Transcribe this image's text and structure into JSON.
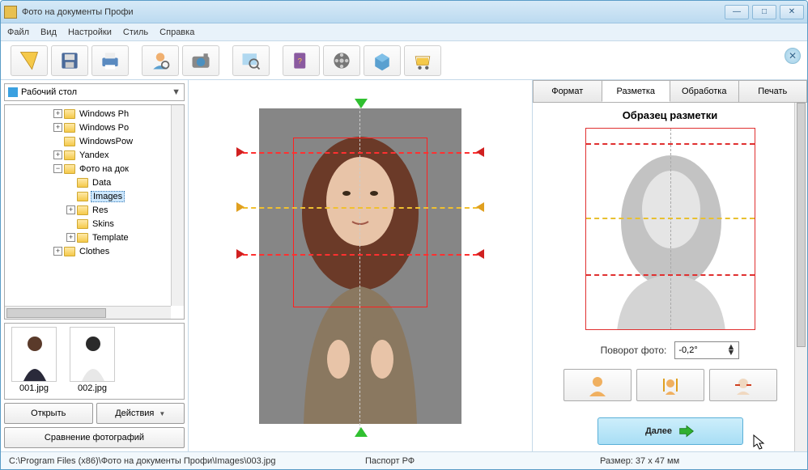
{
  "title": "Фото на документы Профи",
  "menu": {
    "file": "Файл",
    "view": "Вид",
    "settings": "Настройки",
    "style": "Стиль",
    "help": "Справка"
  },
  "folderSelect": "Рабочий стол",
  "tree": {
    "items": [
      {
        "indent": 60,
        "exp": "+",
        "label": "Windows Ph"
      },
      {
        "indent": 60,
        "exp": "+",
        "label": "Windows Po"
      },
      {
        "indent": 60,
        "exp": "",
        "label": "WindowsPow"
      },
      {
        "indent": 60,
        "exp": "+",
        "label": "Yandex"
      },
      {
        "indent": 60,
        "exp": "−",
        "label": "Фото на док"
      },
      {
        "indent": 76,
        "exp": "",
        "label": "Data"
      },
      {
        "indent": 76,
        "exp": "",
        "label": "Images",
        "selected": true
      },
      {
        "indent": 76,
        "exp": "+",
        "label": "Res"
      },
      {
        "indent": 76,
        "exp": "",
        "label": "Skins"
      },
      {
        "indent": 76,
        "exp": "+",
        "label": "Template"
      },
      {
        "indent": 60,
        "exp": "+",
        "label": "Clothes"
      }
    ]
  },
  "thumbs": {
    "items": [
      {
        "name": "001.jpg"
      },
      {
        "name": "002.jpg"
      }
    ]
  },
  "buttons": {
    "open": "Открыть",
    "actions": "Действия",
    "compare": "Сравнение фотографий"
  },
  "tabs": {
    "format": "Формат",
    "markup": "Разметка",
    "process": "Обработка",
    "print": "Печать"
  },
  "sample": {
    "title": "Образец разметки"
  },
  "rotate": {
    "label": "Поворот фото:",
    "value": "-0,2°"
  },
  "next": "Далее",
  "status": {
    "path": "C:\\Program Files (x86)\\Фото на документы Профи\\Images\\003.jpg",
    "format": "Паспорт РФ",
    "size": "Размер: 37 x 47 мм"
  }
}
